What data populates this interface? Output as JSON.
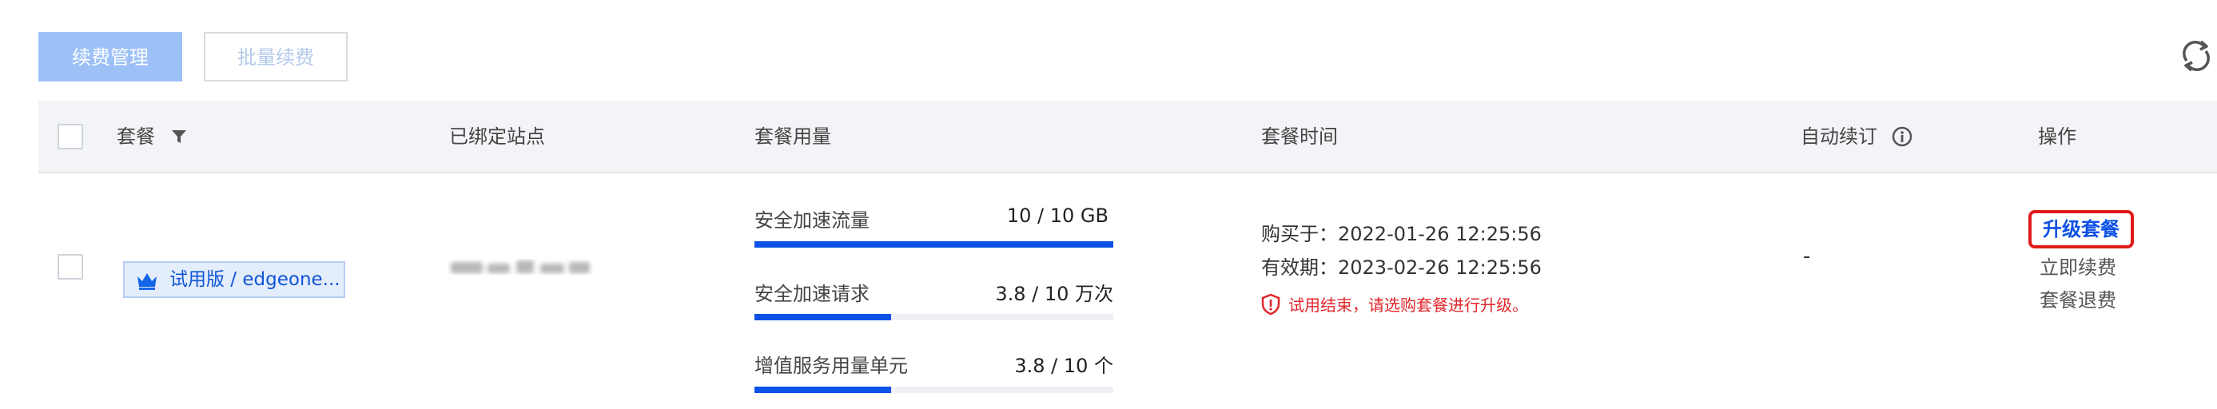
{
  "toolbar": {
    "renew_manage_label": "续费管理",
    "batch_renew_label": "批量续费"
  },
  "icons": {
    "refresh": "refresh-icon",
    "filter": "filter-icon",
    "info": "info-icon",
    "crown": "crown-icon",
    "warning": "shield-warning-icon"
  },
  "colors": {
    "primary": "#0d52e6",
    "primary_disabled": "#9dc1f7",
    "header_bg": "#f3f4f7",
    "warning": "#e0262b",
    "highlight_box": "#e21a1a"
  },
  "table": {
    "headers": {
      "plan": "套餐",
      "bound_sites": "已绑定站点",
      "usage": "套餐用量",
      "plan_time": "套餐时间",
      "auto_renew": "自动续订",
      "actions": "操作"
    },
    "row": {
      "plan_tag": "试用版 / edgeone...",
      "usage": [
        {
          "label": "安全加速流量",
          "value": "10 / 10 GB",
          "percent": 100
        },
        {
          "label": "安全加速请求",
          "value": "3.8 / 10 万次",
          "percent": 38
        },
        {
          "label": "增值服务用量单元",
          "value": "3.8 / 10 个",
          "percent": 38
        }
      ],
      "purchased_at": "购买于：2022-01-26 12:25:56",
      "valid_until": "有效期：2023-02-26 12:25:56",
      "warning_text": "试用结束，请选购套餐进行升级。",
      "auto_renew": "-",
      "actions": {
        "upgrade": "升级套餐",
        "renew_now": "立即续费",
        "refund": "套餐退费"
      }
    }
  }
}
